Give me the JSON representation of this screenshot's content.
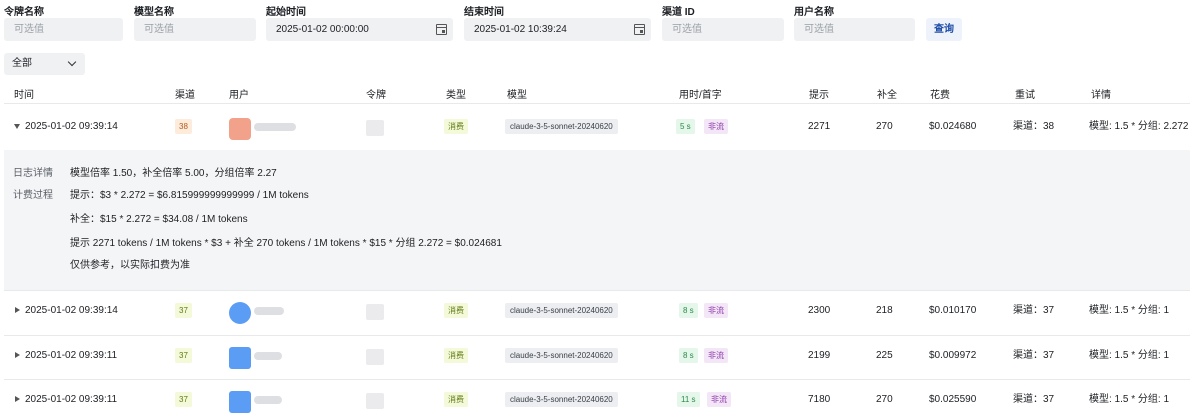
{
  "filters": [
    {
      "label": "令牌名称",
      "placeholder": "可选值"
    },
    {
      "label": "模型名称",
      "placeholder": "可选值"
    },
    {
      "label": "起始时间",
      "value": "2025-01-02 00:00:00"
    },
    {
      "label": "结束时间",
      "value": "2025-01-02 10:39:24"
    },
    {
      "label": "渠道 ID",
      "placeholder": "可选值"
    },
    {
      "label": "用户名称",
      "placeholder": "可选值"
    }
  ],
  "query_button": "查询",
  "type_select": "全部",
  "columns": [
    "时间",
    "渠道",
    "用户",
    "令牌",
    "类型",
    "模型",
    "用时/首字",
    "提示",
    "补全",
    "花费",
    "重试",
    "详情"
  ],
  "rows": [
    {
      "time": "2025-01-02 09:39:14",
      "channel": "38",
      "type": "消费",
      "model": "claude-3-5-sonnet-20240620",
      "duration": "5 s",
      "stream": "非流",
      "prompt": "2271",
      "completion": "270",
      "cost": "$0.024680",
      "retry": "渠道：38",
      "detail": "模型: 1.5 * 分组: 2.272",
      "expanded": true
    },
    {
      "time": "2025-01-02 09:39:14",
      "channel": "37",
      "type": "消费",
      "model": "claude-3-5-sonnet-20240620",
      "duration": "8 s",
      "stream": "非流",
      "prompt": "2300",
      "completion": "218",
      "cost": "$0.010170",
      "retry": "渠道：37",
      "detail": "模型: 1.5 * 分组: 1"
    },
    {
      "time": "2025-01-02 09:39:11",
      "channel": "37",
      "type": "消费",
      "model": "claude-3-5-sonnet-20240620",
      "duration": "8 s",
      "stream": "非流",
      "prompt": "2199",
      "completion": "225",
      "cost": "$0.009972",
      "retry": "渠道：37",
      "detail": "模型: 1.5 * 分组: 1"
    },
    {
      "time": "2025-01-02 09:39:11",
      "channel": "37",
      "type": "消费",
      "model": "claude-3-5-sonnet-20240620",
      "duration": "11 s",
      "stream": "非流",
      "prompt": "7180",
      "completion": "270",
      "cost": "$0.025590",
      "retry": "渠道：37",
      "detail": "模型: 1.5 * 分组: 1"
    }
  ],
  "detail": {
    "log_label": "日志详情",
    "log_text": "模型倍率 1.50，补全倍率 5.00，分组倍率 2.27",
    "billing_label": "计费过程",
    "line1": "提示：$3 * 2.272 = $6.815999999999999 / 1M tokens",
    "line2": "补全：$15 * 2.272 = $34.08 / 1M tokens",
    "line3": "提示 2271 tokens / 1M tokens * $3 + 补全 270 tokens / 1M tokens * $15 * 分组 2.272 = $0.024681",
    "line4": "仅供参考，以实际扣费为准"
  },
  "colors": {
    "avatar_orange": "#f2a18a",
    "avatar_blue": "#5b9df5",
    "query_text": "#1f4fa8"
  }
}
